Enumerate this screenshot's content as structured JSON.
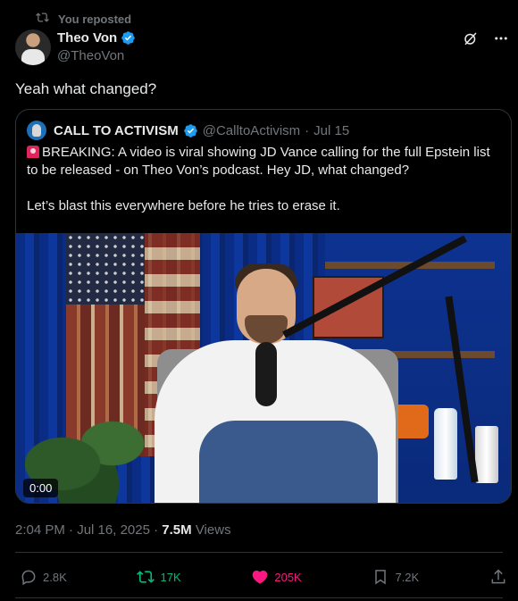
{
  "repost_banner": {
    "text": "You reposted",
    "icon": "repost-icon"
  },
  "author": {
    "name": "Theo Von",
    "handle": "@TheoVon",
    "verified": true
  },
  "top_actions": {
    "grok_icon": "grok-icon",
    "more_icon": "more-icon"
  },
  "tweet": {
    "text": "Yeah what changed?"
  },
  "quoted": {
    "name": "CALL TO ACTIVISM",
    "handle": "@CalltoActivism",
    "separator": "·",
    "date": "Jul 15",
    "paragraph1": "BREAKING: A video is viral showing JD Vance calling for the full Epstein list to be released - on Theo Von’s podcast. Hey JD, what changed?",
    "paragraph1_prefix_icon": "siren-emoji",
    "paragraph2": "Let’s blast this everywhere before he tries to erase it.",
    "video_time": "0:00"
  },
  "meta": {
    "time": "2:04 PM",
    "dot": "·",
    "date": "Jul 16, 2025",
    "views_count": "7.5M",
    "views_label": "Views"
  },
  "actions": {
    "reply_count": "2.8K",
    "repost_count": "17K",
    "like_count": "205K",
    "bookmark_count": "7.2K"
  },
  "colors": {
    "background": "#000000",
    "text": "#e7e9ea",
    "muted": "#71767b",
    "verified": "#1d9bf0",
    "repost_active": "#00ba7c",
    "like_active": "#f91880",
    "border": "#2f3336"
  }
}
